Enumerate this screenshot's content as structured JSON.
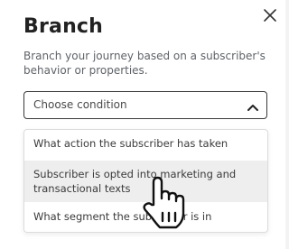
{
  "panel": {
    "title": "Branch",
    "description": "Branch your journey based on a subscriber's behavior or properties."
  },
  "condition_select": {
    "value": "Choose condition",
    "expanded": true
  },
  "condition_options": [
    "What action the subscriber has taken",
    "Subscriber is opted into marketing and transactional texts",
    "What segment the subscriber is in"
  ],
  "icons": {
    "close": "close-icon",
    "chevron": "chevron-up-icon",
    "cursor": "hand-pointer-icon"
  },
  "colors": {
    "text_primary": "#222222",
    "text_secondary": "#5f6368",
    "option_hover_bg": "#eeeeee",
    "select_border": "#3a3a3a"
  }
}
